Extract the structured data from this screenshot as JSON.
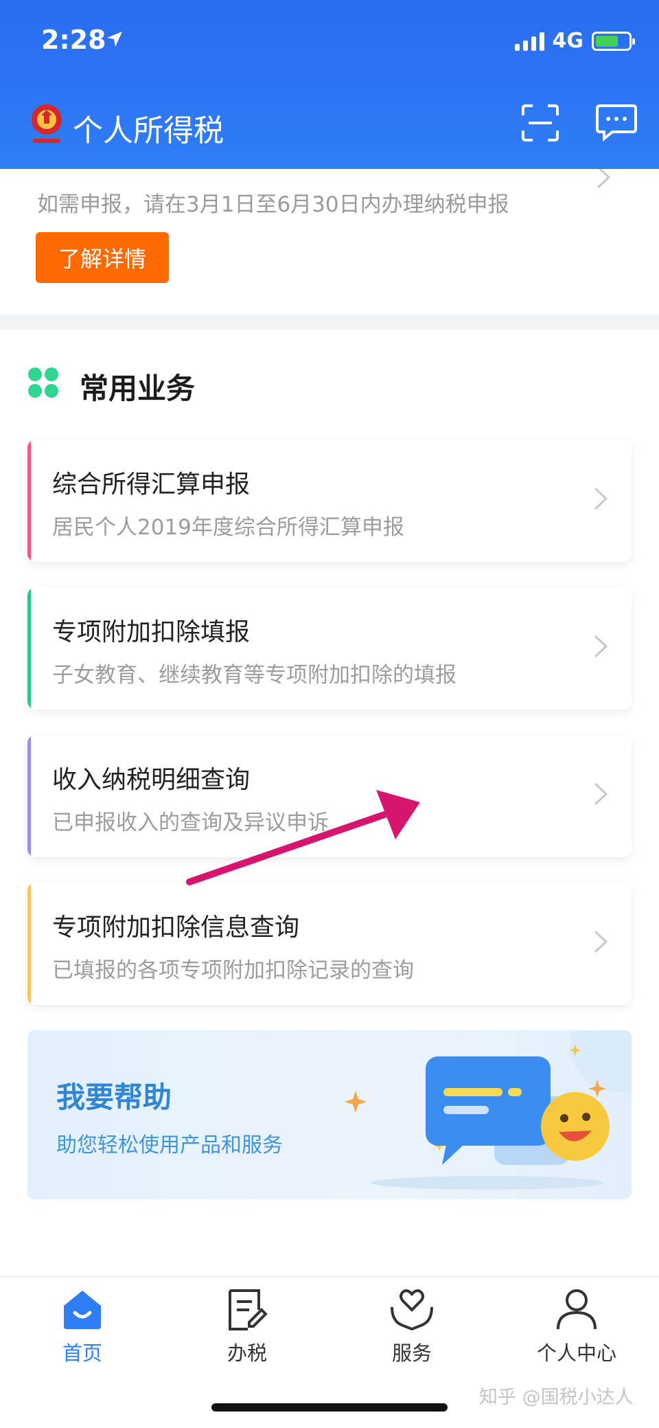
{
  "status_bar": {
    "time": "2:28",
    "network": "4G"
  },
  "header": {
    "title": "个人所得税"
  },
  "notice": {
    "description": "如需申报，请在3月1日至6月30日内办理纳税申报",
    "button_label": "了解详情"
  },
  "section": {
    "title": "常用业务"
  },
  "services": [
    {
      "title": "综合所得汇算申报",
      "subtitle": "居民个人2019年度综合所得汇算申报",
      "accent": "#f0568a"
    },
    {
      "title": "专项附加扣除填报",
      "subtitle": "子女教育、继续教育等专项附加扣除的填报",
      "accent": "#32c28f"
    },
    {
      "title": "收入纳税明细查询",
      "subtitle": "已申报收入的查询及异议申诉",
      "accent": "#9b8cf0"
    },
    {
      "title": "专项附加扣除信息查询",
      "subtitle": "已填报的各项专项附加扣除记录的查询",
      "accent": "#f8c36b"
    }
  ],
  "help_banner": {
    "title": "我要帮助",
    "subtitle": "助您轻松使用产品和服务"
  },
  "tabbar": {
    "tabs": [
      {
        "label": "首页",
        "icon": "home-icon",
        "active": true
      },
      {
        "label": "办税",
        "icon": "document-edit-icon",
        "active": false
      },
      {
        "label": "服务",
        "icon": "heart-hands-icon",
        "active": false
      },
      {
        "label": "个人中心",
        "icon": "person-icon",
        "active": false
      }
    ]
  },
  "watermark": "知乎 @国税小达人",
  "colors": {
    "brand_blue": "#2f7df6",
    "orange": "#ff6a00",
    "annotation_arrow": "#d6156f"
  }
}
